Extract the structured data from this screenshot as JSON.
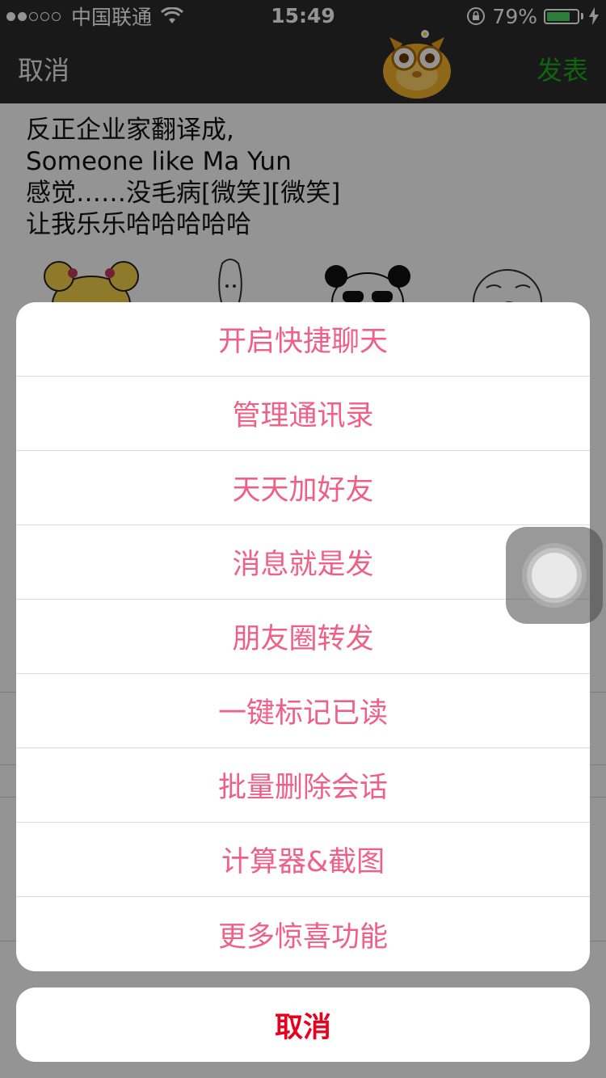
{
  "status_bar": {
    "carrier": "中国联通",
    "time": "15:49",
    "battery_percent": "79%",
    "battery_level": 0.79,
    "icons": [
      "signal-dots-icon",
      "wifi-icon",
      "orientation-lock-icon",
      "battery-icon",
      "charging-bolt-icon"
    ]
  },
  "nav": {
    "cancel_label": "取消",
    "publish_label": "发表",
    "publish_color": "#1aad19"
  },
  "post": {
    "lines": [
      "反正企业家翻译成,",
      "Someone like Ma Yun",
      "感觉……没毛病[微笑][微笑]",
      "让我乐乐哈哈哈哈哈"
    ]
  },
  "action_sheet": {
    "item_color": "#ef5f86",
    "items": [
      "开启快捷聊天",
      "管理通讯录",
      "天天加好友",
      "消息就是发",
      "朋友圈转发",
      "一键标记已读",
      "批量删除会话",
      "计算器&截图",
      "更多惊喜功能"
    ],
    "cancel_label": "取消",
    "cancel_color": "#e8001c"
  }
}
